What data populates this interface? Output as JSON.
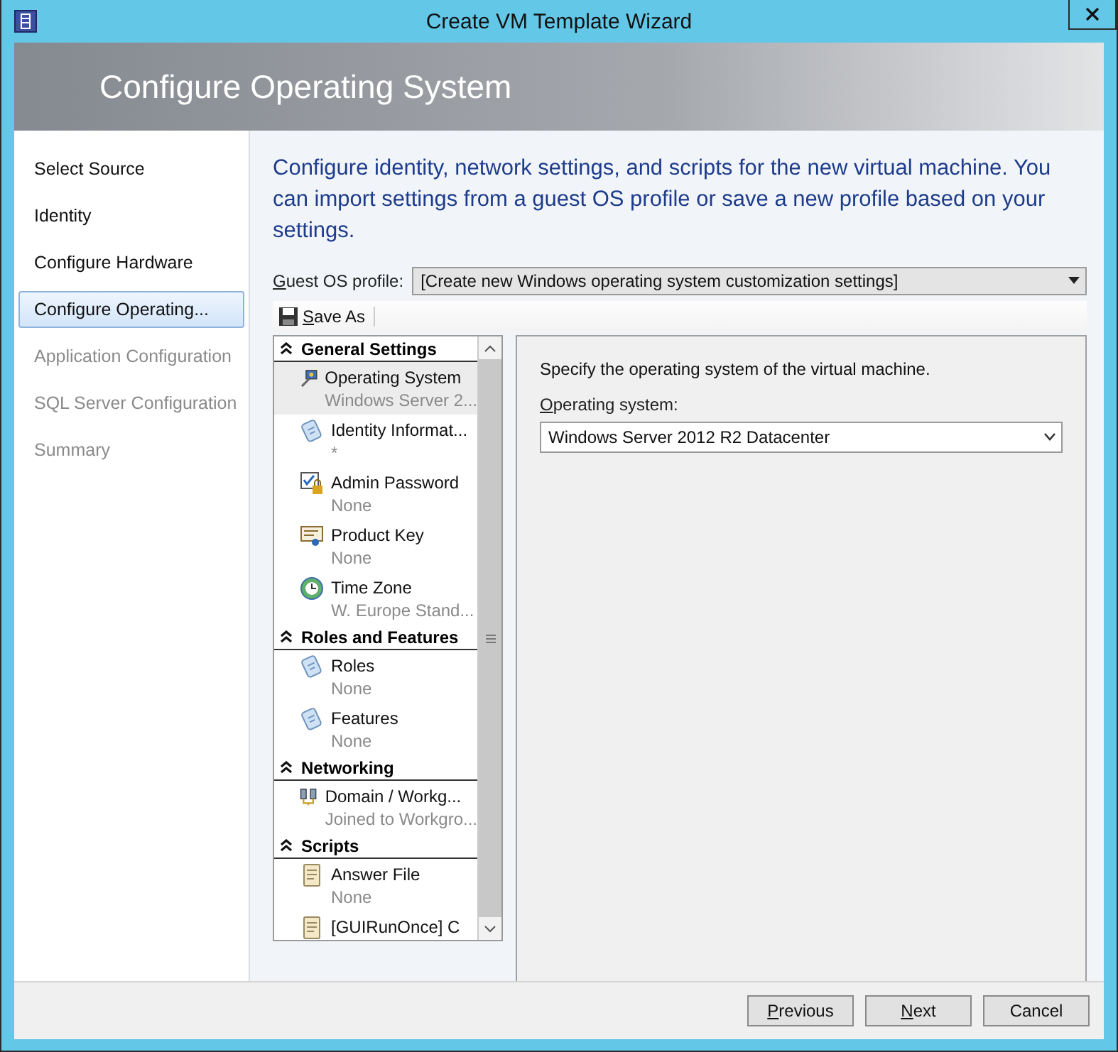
{
  "window": {
    "title": "Create VM Template Wizard"
  },
  "header": {
    "title": "Configure Operating System"
  },
  "steps": [
    {
      "label": "Select Source",
      "selected": false,
      "disabled": false
    },
    {
      "label": "Identity",
      "selected": false,
      "disabled": false
    },
    {
      "label": "Configure Hardware",
      "selected": false,
      "disabled": false
    },
    {
      "label": "Configure Operating...",
      "selected": true,
      "disabled": false
    },
    {
      "label": "Application Configuration",
      "selected": false,
      "disabled": true
    },
    {
      "label": "SQL Server Configuration",
      "selected": false,
      "disabled": true
    },
    {
      "label": "Summary",
      "selected": false,
      "disabled": true
    }
  ],
  "description": "Configure identity, network settings, and scripts for the new virtual machine. You can import settings from a guest OS profile or save a new profile based on your settings.",
  "guest_os_profile": {
    "label": "Guest OS profile:",
    "value": "[Create new Windows operating system customization settings]"
  },
  "toolbar": {
    "save_as": "Save As"
  },
  "tree": [
    {
      "title": "General Settings",
      "expanded": true,
      "items": [
        {
          "kind": "os",
          "name": "Operating System",
          "detail": "Windows Server 2...",
          "selected": true
        },
        {
          "kind": "identity",
          "name": "Identity Informat...",
          "detail": "*",
          "selected": false
        },
        {
          "kind": "password",
          "name": "Admin Password",
          "detail": "None",
          "selected": false
        },
        {
          "kind": "certificate",
          "name": "Product Key",
          "detail": "None",
          "selected": false
        },
        {
          "kind": "clock",
          "name": "Time Zone",
          "detail": "W. Europe Stand...",
          "selected": false
        }
      ]
    },
    {
      "title": "Roles and Features",
      "expanded": true,
      "items": [
        {
          "kind": "identity",
          "name": "Roles",
          "detail": "None",
          "selected": false
        },
        {
          "kind": "identity",
          "name": "Features",
          "detail": "None",
          "selected": false
        }
      ]
    },
    {
      "title": "Networking",
      "expanded": true,
      "items": [
        {
          "kind": "network",
          "name": "Domain / Workg...",
          "detail": "Joined to Workgro...",
          "selected": false
        }
      ]
    },
    {
      "title": "Scripts",
      "expanded": true,
      "items": [
        {
          "kind": "script",
          "name": "Answer File",
          "detail": "None",
          "selected": false
        },
        {
          "kind": "script",
          "name": "[GUIRunOnce] C",
          "selected": false
        }
      ]
    }
  ],
  "details": {
    "intro": "Specify the operating system of the virtual machine.",
    "label": "Operating system:",
    "value": "Windows Server 2012 R2 Datacenter"
  },
  "buttons": [
    {
      "label": "Previous",
      "disabled": false
    },
    {
      "label": "Next",
      "disabled": false
    },
    {
      "label": "Cancel",
      "disabled": false
    }
  ]
}
